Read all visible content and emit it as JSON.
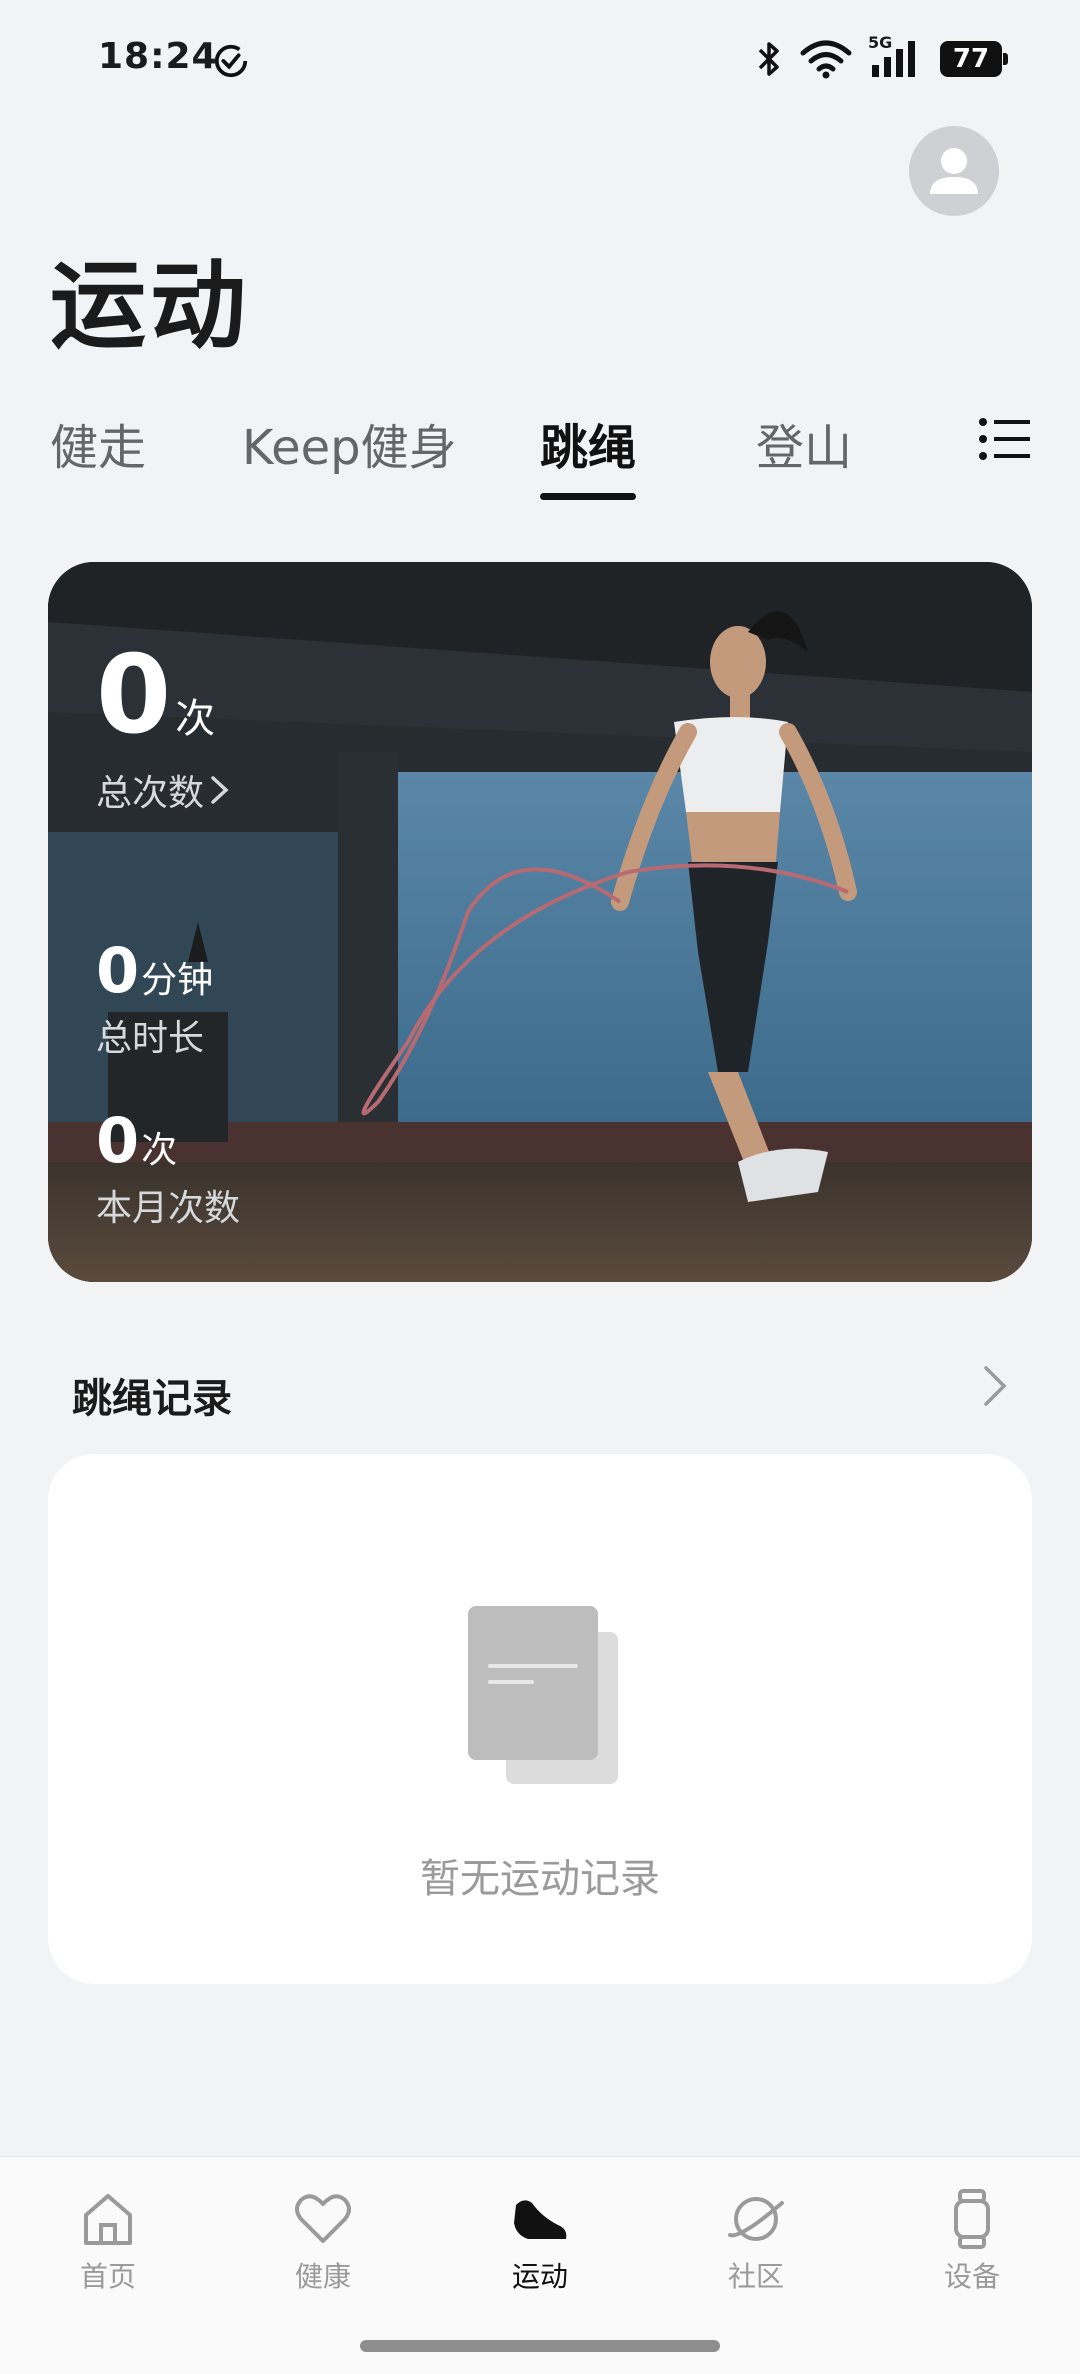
{
  "status_bar": {
    "time": "18:24",
    "network": "5G",
    "battery": "77"
  },
  "header": {
    "title": "运动"
  },
  "tabs": [
    {
      "label": "健走"
    },
    {
      "label": "Keep健身"
    },
    {
      "label": "跳绳"
    },
    {
      "label": "登山"
    }
  ],
  "active_tab": "跳绳",
  "hero": {
    "total_count": "0",
    "total_count_unit": "次",
    "total_count_label": "总次数",
    "total_duration": "0",
    "total_duration_unit": "分钟",
    "total_duration_label": "总时长",
    "month_count": "0",
    "month_count_unit": "次",
    "month_count_label": "本月次数"
  },
  "records": {
    "title": "跳绳记录",
    "empty_text": "暂无运动记录"
  },
  "bottom_nav": [
    {
      "label": "首页",
      "icon": "home-icon"
    },
    {
      "label": "健康",
      "icon": "heart-icon"
    },
    {
      "label": "运动",
      "icon": "shoe-icon"
    },
    {
      "label": "社区",
      "icon": "planet-icon"
    },
    {
      "label": "设备",
      "icon": "watch-icon"
    }
  ],
  "colors": {
    "background": "#f2f3f5",
    "active": "#111111",
    "inactive": "#9a9a9a",
    "card": "#ffffff"
  }
}
